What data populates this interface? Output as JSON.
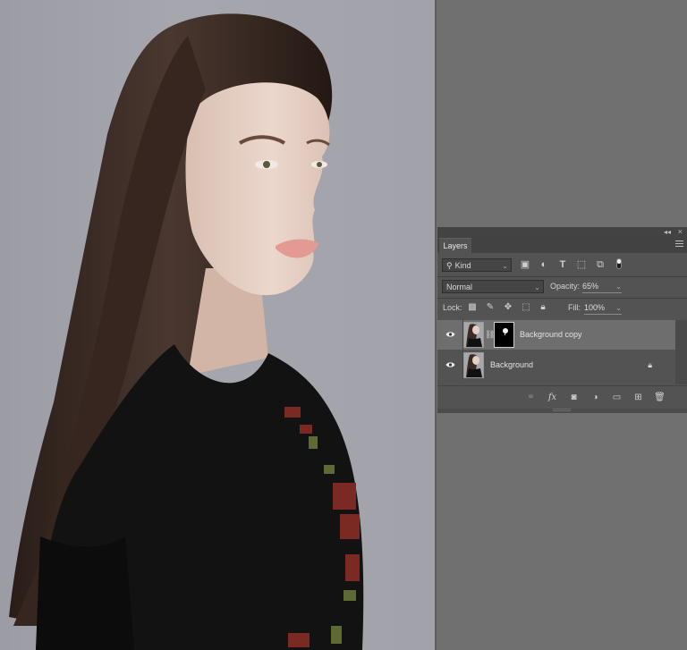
{
  "canvas": {
    "photo_icon": "portrait-photo"
  },
  "panel": {
    "tab_label": "Layers",
    "filter": {
      "kind_label": "Kind",
      "icons": [
        "pixel-filter-icon",
        "adjustment-filter-icon",
        "type-filter-icon",
        "shape-filter-icon",
        "smart-object-filter-icon"
      ]
    },
    "blend_mode": "Normal",
    "opacity_label": "Opacity:",
    "opacity_value": "65%",
    "lock_label": "Lock:",
    "fill_label": "Fill:",
    "fill_value": "100%",
    "layers": [
      {
        "name": "Background copy",
        "visible": true,
        "selected": true,
        "has_mask": true
      },
      {
        "name": "Background",
        "visible": true,
        "selected": false,
        "locked": true
      }
    ]
  },
  "colors": {
    "canvas_bg": "#a4a4ac",
    "panel_bg": "#535353",
    "selected_row": "#6e6e6e",
    "workspace": "#707070"
  }
}
